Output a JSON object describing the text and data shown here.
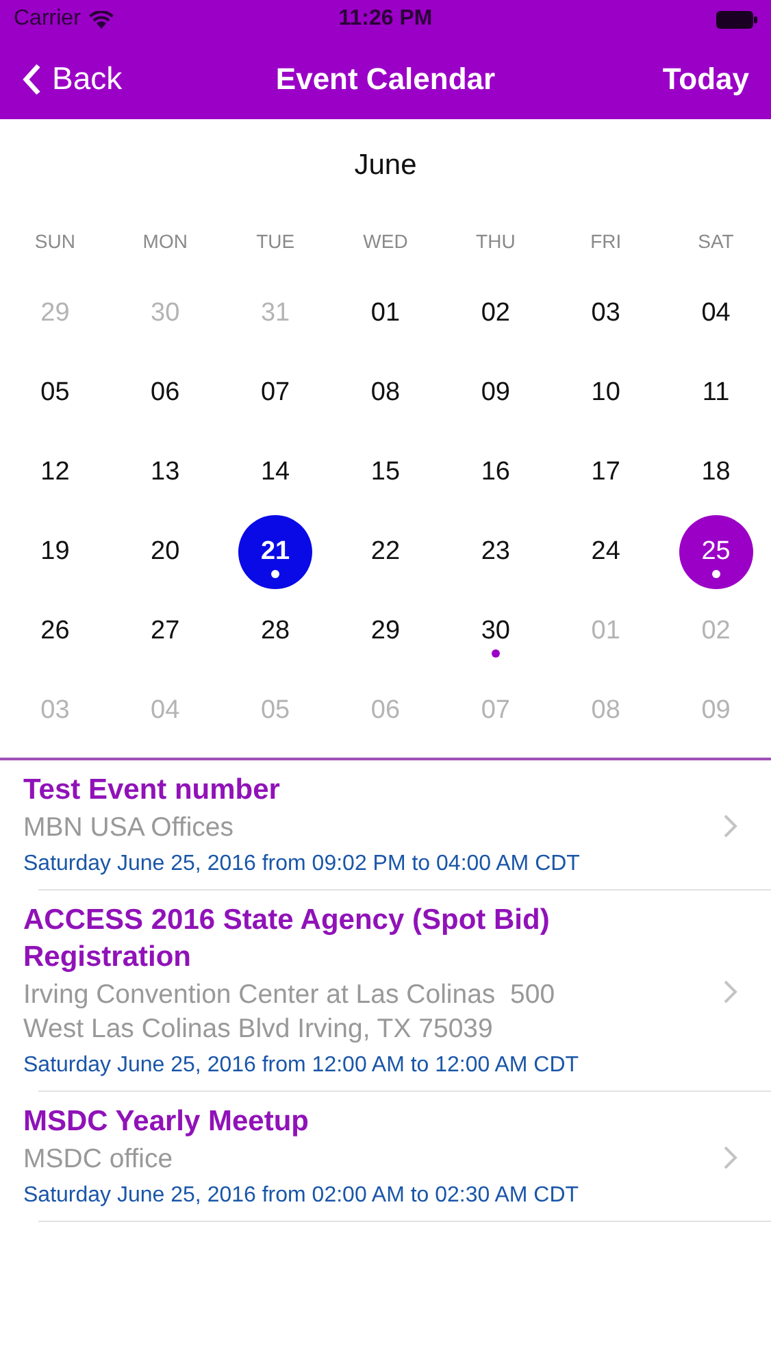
{
  "status_bar": {
    "carrier": "Carrier",
    "time": "11:26 PM"
  },
  "nav": {
    "back": "Back",
    "title": "Event Calendar",
    "action": "Today"
  },
  "calendar": {
    "month": "June",
    "weekdays": [
      "SUN",
      "MON",
      "TUE",
      "WED",
      "THU",
      "FRI",
      "SAT"
    ],
    "days": [
      {
        "day": "29",
        "in_month": false,
        "today": false,
        "selected": false,
        "has_event": false
      },
      {
        "day": "30",
        "in_month": false,
        "today": false,
        "selected": false,
        "has_event": false
      },
      {
        "day": "31",
        "in_month": false,
        "today": false,
        "selected": false,
        "has_event": false
      },
      {
        "day": "01",
        "in_month": true,
        "today": false,
        "selected": false,
        "has_event": false
      },
      {
        "day": "02",
        "in_month": true,
        "today": false,
        "selected": false,
        "has_event": false
      },
      {
        "day": "03",
        "in_month": true,
        "today": false,
        "selected": false,
        "has_event": false
      },
      {
        "day": "04",
        "in_month": true,
        "today": false,
        "selected": false,
        "has_event": false
      },
      {
        "day": "05",
        "in_month": true,
        "today": false,
        "selected": false,
        "has_event": false
      },
      {
        "day": "06",
        "in_month": true,
        "today": false,
        "selected": false,
        "has_event": false
      },
      {
        "day": "07",
        "in_month": true,
        "today": false,
        "selected": false,
        "has_event": false
      },
      {
        "day": "08",
        "in_month": true,
        "today": false,
        "selected": false,
        "has_event": false
      },
      {
        "day": "09",
        "in_month": true,
        "today": false,
        "selected": false,
        "has_event": false
      },
      {
        "day": "10",
        "in_month": true,
        "today": false,
        "selected": false,
        "has_event": false
      },
      {
        "day": "11",
        "in_month": true,
        "today": false,
        "selected": false,
        "has_event": false
      },
      {
        "day": "12",
        "in_month": true,
        "today": false,
        "selected": false,
        "has_event": false
      },
      {
        "day": "13",
        "in_month": true,
        "today": false,
        "selected": false,
        "has_event": false
      },
      {
        "day": "14",
        "in_month": true,
        "today": false,
        "selected": false,
        "has_event": false
      },
      {
        "day": "15",
        "in_month": true,
        "today": false,
        "selected": false,
        "has_event": false
      },
      {
        "day": "16",
        "in_month": true,
        "today": false,
        "selected": false,
        "has_event": false
      },
      {
        "day": "17",
        "in_month": true,
        "today": false,
        "selected": false,
        "has_event": false
      },
      {
        "day": "18",
        "in_month": true,
        "today": false,
        "selected": false,
        "has_event": false
      },
      {
        "day": "19",
        "in_month": true,
        "today": false,
        "selected": false,
        "has_event": false
      },
      {
        "day": "20",
        "in_month": true,
        "today": false,
        "selected": false,
        "has_event": false
      },
      {
        "day": "21",
        "in_month": true,
        "today": true,
        "selected": false,
        "has_event": true
      },
      {
        "day": "22",
        "in_month": true,
        "today": false,
        "selected": false,
        "has_event": false
      },
      {
        "day": "23",
        "in_month": true,
        "today": false,
        "selected": false,
        "has_event": false
      },
      {
        "day": "24",
        "in_month": true,
        "today": false,
        "selected": false,
        "has_event": false
      },
      {
        "day": "25",
        "in_month": true,
        "today": false,
        "selected": true,
        "has_event": true
      },
      {
        "day": "26",
        "in_month": true,
        "today": false,
        "selected": false,
        "has_event": false
      },
      {
        "day": "27",
        "in_month": true,
        "today": false,
        "selected": false,
        "has_event": false
      },
      {
        "day": "28",
        "in_month": true,
        "today": false,
        "selected": false,
        "has_event": false
      },
      {
        "day": "29",
        "in_month": true,
        "today": false,
        "selected": false,
        "has_event": false
      },
      {
        "day": "30",
        "in_month": true,
        "today": false,
        "selected": false,
        "has_event": true
      },
      {
        "day": "01",
        "in_month": false,
        "today": false,
        "selected": false,
        "has_event": false
      },
      {
        "day": "02",
        "in_month": false,
        "today": false,
        "selected": false,
        "has_event": false
      },
      {
        "day": "03",
        "in_month": false,
        "today": false,
        "selected": false,
        "has_event": false
      },
      {
        "day": "04",
        "in_month": false,
        "today": false,
        "selected": false,
        "has_event": false
      },
      {
        "day": "05",
        "in_month": false,
        "today": false,
        "selected": false,
        "has_event": false
      },
      {
        "day": "06",
        "in_month": false,
        "today": false,
        "selected": false,
        "has_event": false
      },
      {
        "day": "07",
        "in_month": false,
        "today": false,
        "selected": false,
        "has_event": false
      },
      {
        "day": "08",
        "in_month": false,
        "today": false,
        "selected": false,
        "has_event": false
      },
      {
        "day": "09",
        "in_month": false,
        "today": false,
        "selected": false,
        "has_event": false
      }
    ]
  },
  "events": [
    {
      "title": "Test Event number",
      "location": "MBN USA Offices",
      "when": "Saturday June 25, 2016 from 09:02 PM to 04:00 AM CDT"
    },
    {
      "title": "ACCESS 2016 State Agency (Spot Bid) Registration",
      "location": "Irving Convention Center at Las Colinas  500 West Las Colinas Blvd Irving, TX 75039",
      "when": "Saturday June 25, 2016 from 12:00 AM to 12:00 AM CDT"
    },
    {
      "title": "MSDC Yearly Meetup",
      "location": "MSDC office",
      "when": "Saturday June 25, 2016 from 02:00 AM to 02:30 AM CDT"
    }
  ]
}
